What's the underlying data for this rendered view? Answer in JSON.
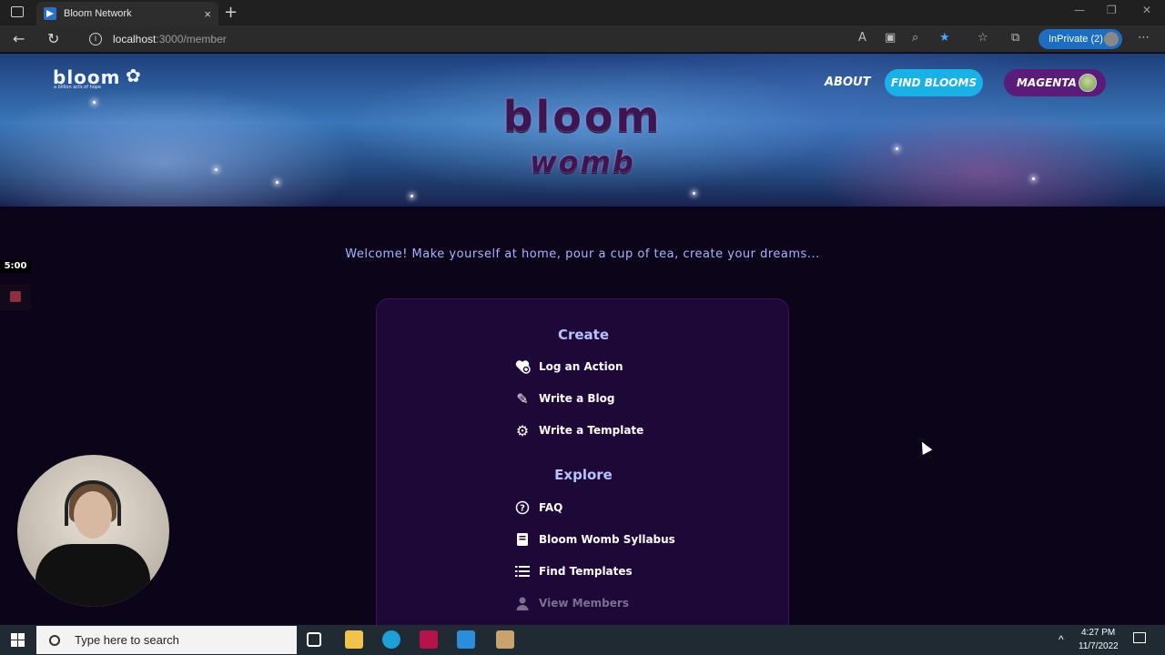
{
  "browser": {
    "tab_title": "Bloom Network",
    "tab_close": "×",
    "new_tab": "+",
    "url_host": "localhost",
    "url_path": ":3000/member",
    "inprivate_label": "InPrivate (2)"
  },
  "header": {
    "logo_text": "bloom",
    "logo_tagline": "a billion acts of hope",
    "title": "bloom",
    "subtitle": "womb",
    "nav": {
      "about": "ABOUT",
      "find_blooms": "FIND BLOOMS",
      "user": "MAGENTA"
    }
  },
  "overlay": {
    "timer": "5:00"
  },
  "main": {
    "welcome": "Welcome! Make yourself at home, pour a cup of tea, create your dreams...",
    "create": {
      "heading": "Create",
      "items": [
        {
          "label": "Log an Action",
          "icon": "heart-plus-icon"
        },
        {
          "label": "Write a Blog",
          "icon": "pencil-icon"
        },
        {
          "label": "Write a Template",
          "icon": "gear-icon"
        }
      ]
    },
    "explore": {
      "heading": "Explore",
      "items": [
        {
          "label": "FAQ",
          "icon": "question-circle-icon"
        },
        {
          "label": "Bloom Womb Syllabus",
          "icon": "book-icon"
        },
        {
          "label": "Find Templates",
          "icon": "list-icon"
        },
        {
          "label": "View Members",
          "icon": "person-icon",
          "disabled": true
        }
      ]
    }
  },
  "taskbar": {
    "search_placeholder": "Type here to search",
    "time": "4:27 PM",
    "date": "11/7/2022"
  },
  "colors": {
    "accent_find": "#19b2e8",
    "accent_user": "#5a1b79",
    "card_bg": "#1e0837",
    "heading_text": "#b8c2ff"
  }
}
